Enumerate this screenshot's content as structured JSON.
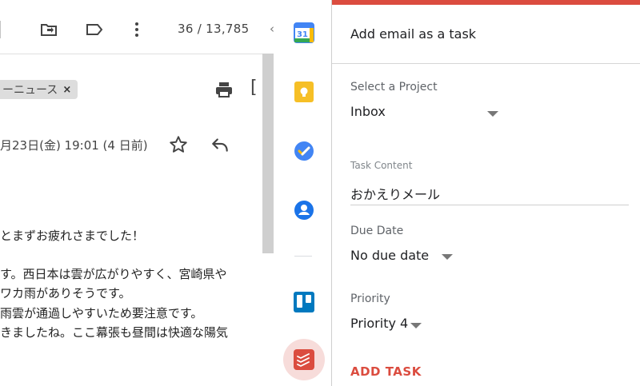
{
  "email_toolbar": {
    "counter": "36 / 13,785",
    "icons": [
      "move-to-folder-icon",
      "label-icon",
      "more-vert-icon"
    ],
    "partial_arrow": "‹"
  },
  "email": {
    "label_chip": "ーニュース",
    "label_chip_close": "×",
    "date": "月23日(金) 19:01 (4 日前)",
    "partial_bracket": "[",
    "body_lines": [
      "とまずお疲れさまでした！",
      "す。西日本は雲が広がりやすく、宮崎県や",
      "ワカ雨がありそうです。",
      "雨雲が通過しやすいため要注意です。",
      "きましたね。ここ幕張も昼間は快適な陽気"
    ]
  },
  "side_apps": {
    "calendar_day": "31",
    "items": [
      "google-calendar-icon",
      "google-keep-icon",
      "google-tasks-icon",
      "contacts-icon",
      "trello-icon",
      "todoist-icon"
    ]
  },
  "task_panel": {
    "title": "Add email as a task",
    "project_label": "Select a Project",
    "project_value": "Inbox",
    "content_label": "Task Content",
    "content_value": "おかえりメール",
    "due_label": "Due Date",
    "due_value": "No due date",
    "priority_label": "Priority",
    "priority_value": "Priority 4",
    "add_button": "ADD TASK"
  },
  "colors": {
    "accent": "#db4c3f",
    "calendar_blue": "#4285f4",
    "keep_yellow": "#f6bf26",
    "trello_blue": "#0079bf"
  }
}
